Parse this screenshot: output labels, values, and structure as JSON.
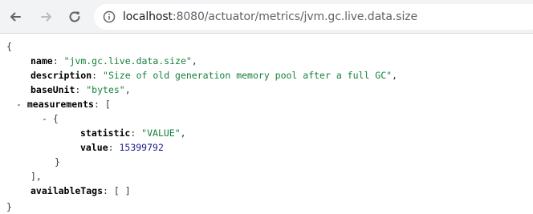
{
  "browser": {
    "url_host": "localhost",
    "url_path": ":8080/actuator/metrics/jvm.gc.live.data.size"
  },
  "json": {
    "open_brace": "{",
    "close_brace": "}",
    "name_key": "name",
    "name_value": "\"jvm.gc.live.data.size\"",
    "description_key": "description",
    "description_value": "\"Size of old generation memory pool after a full GC\"",
    "baseUnit_key": "baseUnit",
    "baseUnit_value": "\"bytes\"",
    "measurements_key": "measurements",
    "measurements_open": "[",
    "measurement_open": "{",
    "statistic_key": "statistic",
    "statistic_value": "\"VALUE\"",
    "value_key": "value",
    "value_value": "15399792",
    "measurement_close": "}",
    "measurements_close": "],",
    "availableTags_key": "availableTags",
    "availableTags_value": "[ ]",
    "collapse_toggle": "-"
  },
  "colors": {
    "string": "#14813a",
    "number": "#1a1a8c",
    "key": "#000000"
  }
}
